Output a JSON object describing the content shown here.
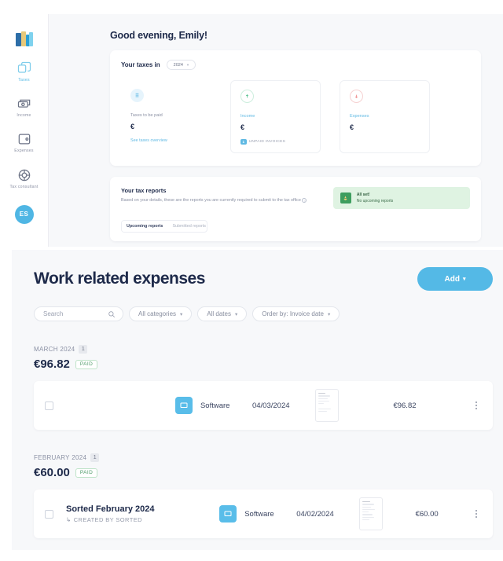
{
  "dashboard": {
    "sidebar": {
      "logo_name": "sorted-logo-icon",
      "items": [
        {
          "label": "Taxes",
          "icon": "taxes-icon",
          "active": true
        },
        {
          "label": "Income",
          "icon": "income-icon",
          "active": false
        },
        {
          "label": "Expenses",
          "icon": "expenses-wallet-icon",
          "active": false
        },
        {
          "label": "Tax consultant",
          "icon": "tax-consultant-icon",
          "active": false
        }
      ],
      "avatar_initials": "ES"
    },
    "greeting": "Good evening, Emily!",
    "taxes_card": {
      "title": "Your taxes in",
      "year": "2024",
      "columns": [
        {
          "label": "Taxes to be paid",
          "amount": "€",
          "link": "See taxes overview",
          "icon": "receipt-icon",
          "accent": "#5fb9e3"
        },
        {
          "label": "Income",
          "amount": "€",
          "badge_count": "1",
          "badge_text": "UNPAID INVOICES",
          "icon": "income-arrow-icon",
          "accent": "#4cbf8a"
        },
        {
          "label": "Expenses",
          "amount": "€",
          "icon": "expenses-arrow-icon",
          "accent": "#ef8080"
        }
      ]
    },
    "reports_card": {
      "title": "Your tax reports",
      "description": "Based on your details, these are the reports you are currently required to submit to the tax office",
      "status_title": "All set!",
      "status_subtitle": "No upcoming reports",
      "tabs": [
        {
          "label": "Upcoming reports",
          "active": true
        },
        {
          "label": "Submitted reports",
          "active": false
        }
      ]
    }
  },
  "expenses": {
    "title": "Work related expenses",
    "add_button": "Add",
    "add_caret": "▾",
    "filters": {
      "search_placeholder": "Search",
      "search_value": "",
      "categories": "All categories",
      "dates": "All dates",
      "order_by": "Order by:  Invoice date",
      "caret": "▾"
    },
    "groups": [
      {
        "month": "MARCH 2024",
        "count": "1",
        "total": "€96.82",
        "status": "PAID",
        "rows": [
          {
            "title": "",
            "subtitle": "",
            "category": "Software",
            "category_icon": "software-monitor-icon",
            "date": "04/03/2024",
            "amount": "€96.82",
            "thumbnail": "receipt-thumbnail"
          }
        ]
      },
      {
        "month": "FEBRUARY 2024",
        "count": "1",
        "total": "€60.00",
        "status": "PAID",
        "rows": [
          {
            "title": "Sorted February 2024",
            "subtitle": "CREATED BY SORTED",
            "subtitle_arrow": "↳",
            "category": "Software",
            "category_icon": "software-monitor-icon",
            "date": "04/02/2024",
            "amount": "€60.00",
            "thumbnail": "receipt-thumbnail"
          }
        ]
      }
    ]
  },
  "colors": {
    "accent_blue": "#54b9e6",
    "navy": "#1e2a4a",
    "paid_green": "#4d9a68",
    "page_bg": "#f7f8fa"
  }
}
